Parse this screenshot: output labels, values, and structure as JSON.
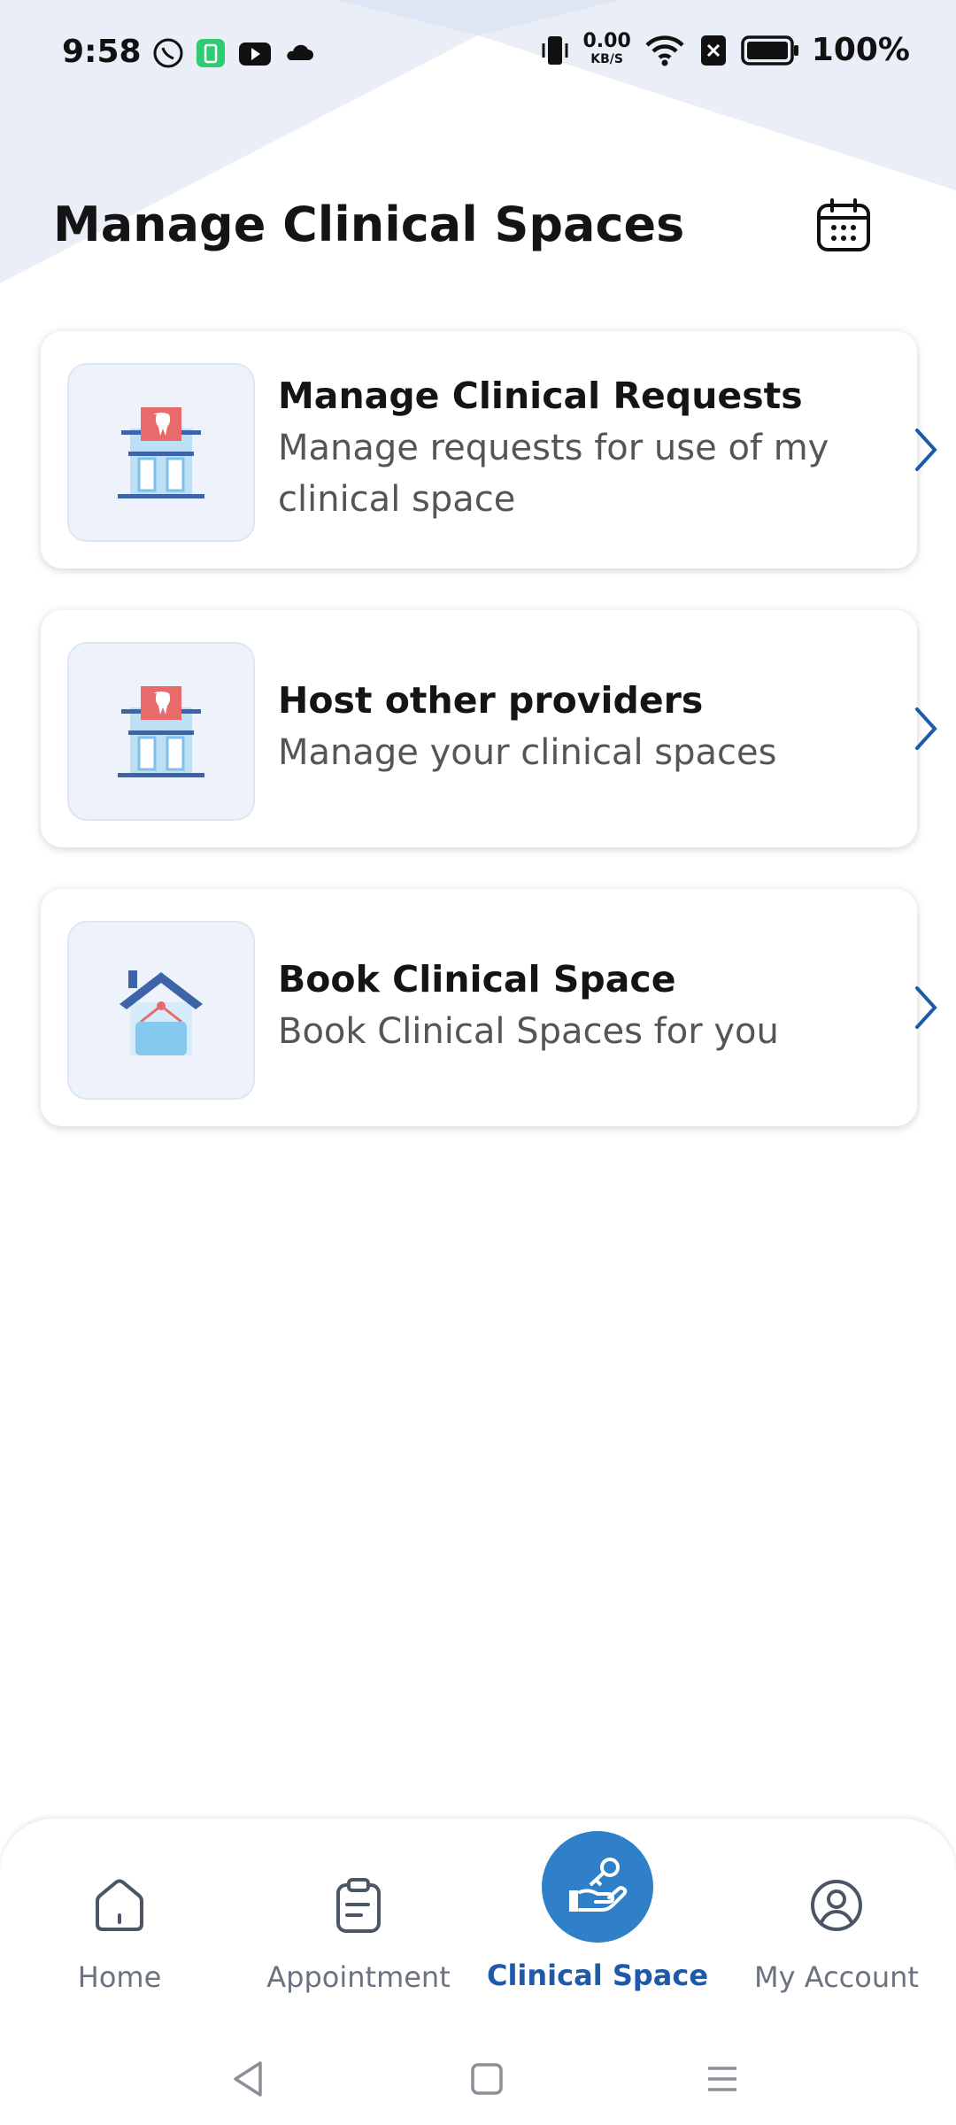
{
  "status_bar": {
    "time": "9:58",
    "net_speed_value": "0.00",
    "net_speed_unit": "KB/S",
    "battery_percent": "100%"
  },
  "header": {
    "title": "Manage Clinical Spaces",
    "calendar_icon": "calendar-icon"
  },
  "cards": [
    {
      "title": "Manage Clinical Requests",
      "description": "Manage requests for use of my clinical space",
      "icon": "clinic-building-icon"
    },
    {
      "title": "Host other providers",
      "description": "Manage your clinical spaces",
      "icon": "clinic-building-icon"
    },
    {
      "title": "Book Clinical Space",
      "description": "Book Clinical Spaces for you",
      "icon": "house-sign-icon"
    }
  ],
  "bottom_nav": {
    "items": [
      {
        "label": "Home",
        "icon": "home-icon",
        "active": false
      },
      {
        "label": "Appointment",
        "icon": "clipboard-icon",
        "active": false
      },
      {
        "label": "Clinical Space",
        "icon": "hand-key-icon",
        "active": true
      },
      {
        "label": "My Account",
        "icon": "user-circle-icon",
        "active": false
      }
    ]
  },
  "colors": {
    "accent": "#2f80c9",
    "active_label": "#1e5aa8",
    "chevron": "#1e5aa8",
    "header_bg": "#e9eef7"
  }
}
